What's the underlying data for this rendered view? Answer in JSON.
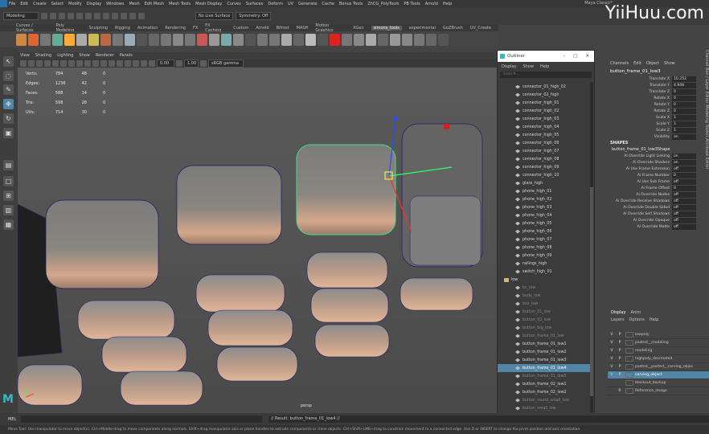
{
  "menubar": {
    "items": [
      "File",
      "Edit",
      "Create",
      "Select",
      "Modify",
      "Display",
      "Windows",
      "Mesh",
      "Edit Mesh",
      "Mesh Tools",
      "Mesh Display",
      "Curves",
      "Surfaces",
      "Deform",
      "UV",
      "Generate",
      "Cache",
      "Bonus Tools",
      "ZhCG_PolyTools",
      "PB Tools",
      "Arnold",
      "Help"
    ],
    "window_title": "Maya Classic*"
  },
  "statusline": {
    "mode": "Modeling",
    "live_surface": "No Live Surface",
    "symmetry": "Symmetry: Off"
  },
  "shelf_tabs": [
    "Curves / Surfaces",
    "Poly Modeling",
    "Sculpting",
    "Rigging",
    "Animation",
    "Rendering",
    "FX",
    "FX Caching",
    "Custom",
    "Arnold",
    "Bifrost",
    "MASH",
    "Motion Graphics",
    "XGen",
    "simons_tools",
    "experimental",
    "GoZBrush",
    "UV_Create"
  ],
  "shelf_active": "simons_tools",
  "panel": {
    "menus": [
      "View",
      "Shading",
      "Lighting",
      "Show",
      "Renderer",
      "Panels"
    ],
    "value_a": "0.00",
    "value_b": "1.00",
    "colorspace": "sRGB gamma",
    "camera": "persp"
  },
  "hud": {
    "rows": [
      {
        "label": "Verts:",
        "a": "784",
        "b": "48",
        "c": "0"
      },
      {
        "label": "Edges:",
        "a": "1236",
        "b": "42",
        "c": "0"
      },
      {
        "label": "Faces:",
        "a": "588",
        "b": "14",
        "c": "0"
      },
      {
        "label": "Tris:",
        "a": "598",
        "b": "28",
        "c": "0"
      },
      {
        "label": "UVs:",
        "a": "714",
        "b": "30",
        "c": "0"
      }
    ]
  },
  "outliner": {
    "title": "Outliner",
    "menus": [
      "Display",
      "Show",
      "Help"
    ],
    "search_placeholder": "Search...",
    "items": [
      {
        "label": "connector_01_high_02",
        "state": "normal"
      },
      {
        "label": "connector_02_high",
        "state": "normal"
      },
      {
        "label": "connector_high_01",
        "state": "normal"
      },
      {
        "label": "connector_high_02",
        "state": "normal"
      },
      {
        "label": "connector_high_03",
        "state": "normal"
      },
      {
        "label": "connector_high_04",
        "state": "normal"
      },
      {
        "label": "connector_high_05",
        "state": "normal"
      },
      {
        "label": "connector_high_06",
        "state": "normal"
      },
      {
        "label": "connector_high_07",
        "state": "normal"
      },
      {
        "label": "connector_high_08",
        "state": "normal"
      },
      {
        "label": "connector_high_09",
        "state": "normal"
      },
      {
        "label": "connector_high_10",
        "state": "normal"
      },
      {
        "label": "glass_high",
        "state": "normal"
      },
      {
        "label": "phone_high_01",
        "state": "normal"
      },
      {
        "label": "phone_high_02",
        "state": "normal"
      },
      {
        "label": "phone_high_03",
        "state": "normal"
      },
      {
        "label": "phone_high_04",
        "state": "normal"
      },
      {
        "label": "phone_high_05",
        "state": "normal"
      },
      {
        "label": "phone_high_06",
        "state": "normal"
      },
      {
        "label": "phone_high_07",
        "state": "normal"
      },
      {
        "label": "phone_high_08",
        "state": "normal"
      },
      {
        "label": "phone_high_09",
        "state": "normal"
      },
      {
        "label": "railings_high",
        "state": "normal"
      },
      {
        "label": "switch_high_01",
        "state": "normal"
      },
      {
        "label": "low",
        "state": "group"
      },
      {
        "label": "bc_low",
        "state": "dim"
      },
      {
        "label": "body_low",
        "state": "dim"
      },
      {
        "label": "box_low",
        "state": "dim"
      },
      {
        "label": "button_01_low",
        "state": "dim"
      },
      {
        "label": "button_02_low",
        "state": "dim"
      },
      {
        "label": "button_big_low",
        "state": "dim"
      },
      {
        "label": "button_frame_01_low",
        "state": "dim"
      },
      {
        "label": "button_frame_01_low1",
        "state": "normal"
      },
      {
        "label": "button_frame_01_low2",
        "state": "normal"
      },
      {
        "label": "button_frame_01_low3",
        "state": "normal"
      },
      {
        "label": "button_frame_01_low4",
        "state": "sel"
      },
      {
        "label": "button_frame_01_low5",
        "state": "dim"
      },
      {
        "label": "button_frame_02_low1",
        "state": "normal"
      },
      {
        "label": "button_frame_02_low2",
        "state": "normal"
      },
      {
        "label": "button_round_small_low",
        "state": "dim"
      },
      {
        "label": "button_small_low",
        "state": "dim"
      }
    ]
  },
  "channelbox": {
    "tabs": [
      "Channels",
      "Edit",
      "Object",
      "Show"
    ],
    "object_name": "button_frame_01_low3",
    "attrs": [
      {
        "label": "Translate X",
        "value": "10.252"
      },
      {
        "label": "Translate Y",
        "value": "4.946"
      },
      {
        "label": "Translate Z",
        "value": "0"
      },
      {
        "label": "Rotate X",
        "value": "0"
      },
      {
        "label": "Rotate Y",
        "value": "0"
      },
      {
        "label": "Rotate Z",
        "value": "0"
      },
      {
        "label": "Scale X",
        "value": "1"
      },
      {
        "label": "Scale Y",
        "value": "1"
      },
      {
        "label": "Scale Z",
        "value": "1"
      },
      {
        "label": "Visibility",
        "value": "on"
      }
    ],
    "shapes_header": "SHAPES",
    "shape_name": "button_frame_01_low3Shape",
    "shape_attrs": [
      {
        "label": "Ai Override Light Linking",
        "value": "on"
      },
      {
        "label": "Ai Override Shaders",
        "value": "on"
      },
      {
        "label": "Ai Use Frame Extension",
        "value": "off"
      },
      {
        "label": "Ai Frame Number",
        "value": "0"
      },
      {
        "label": "Ai Use Sub Frame",
        "value": "off"
      },
      {
        "label": "Ai Frame Offset",
        "value": "0"
      },
      {
        "label": "Ai Override Nodes",
        "value": "off"
      },
      {
        "label": "Ai Override Receive Shadows",
        "value": "off"
      },
      {
        "label": "Ai Override Double Sided",
        "value": "off"
      },
      {
        "label": "Ai Override Self Shadows",
        "value": "off"
      },
      {
        "label": "Ai Override Opaque",
        "value": "off"
      },
      {
        "label": "Ai Override Matte",
        "value": "off"
      }
    ]
  },
  "layers": {
    "tabs": [
      "Display",
      "Anim"
    ],
    "menus": [
      "Layers",
      "Options",
      "Help"
    ],
    "items": [
      {
        "v": "V",
        "p": "P",
        "name": "lowpoly",
        "sel": false
      },
      {
        "v": "V",
        "p": "P",
        "name": "pasted__modeling",
        "sel": false
      },
      {
        "v": "V",
        "p": "P",
        "name": "modeling",
        "sel": false
      },
      {
        "v": "V",
        "p": "P",
        "name": "highpoly_decimated",
        "sel": false
      },
      {
        "v": "V",
        "p": "P",
        "name": "pasted__pasted__carving_objec",
        "sel": false
      },
      {
        "v": "V",
        "p": "P",
        "name": "carving_object",
        "sel": true
      },
      {
        "v": "",
        "p": "",
        "name": "blockout_backup",
        "sel": false
      },
      {
        "v": "",
        "p": "R",
        "name": "Reference_image",
        "sel": false
      }
    ]
  },
  "cmdline": {
    "lang": "MEL",
    "result": "// Result: button_frame_01_low4 //"
  },
  "helpline": "Move Tool: Use manipulator to move object(s). Ctrl+Middle-drag to move components along normals. Shift+drag manipulator axis or plane handles to extrude components or clone objects. Ctrl+Shift+LMB+drag to constrain movement to a connected edge. Use D or INSERT to change the pivot position and axis orientation.",
  "side_tabs": "Channel Box / Layer Editor   Modeling Toolkit   Attribute Editor",
  "watermark": "YiiHuu.com"
}
